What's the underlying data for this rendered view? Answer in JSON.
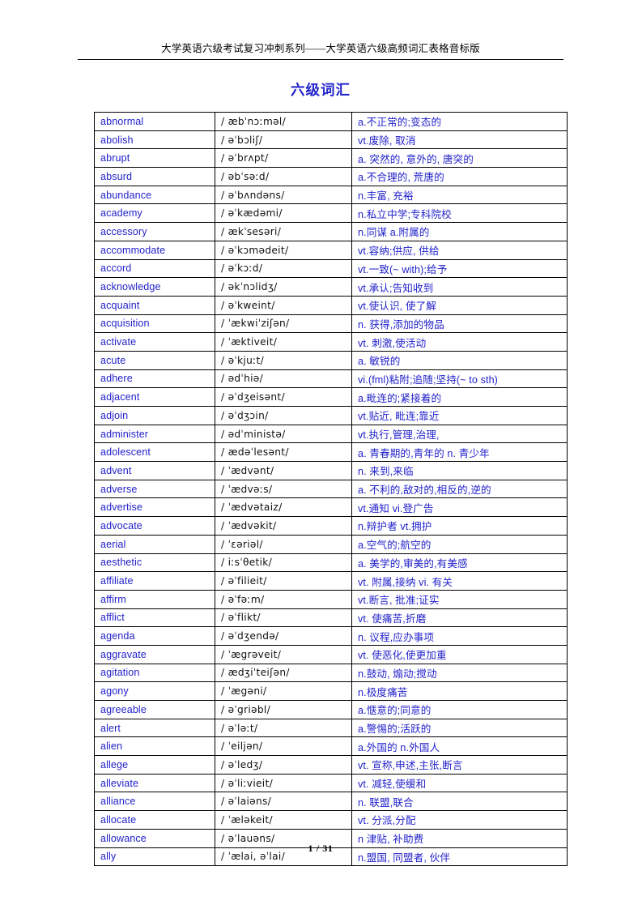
{
  "header": {
    "running_head": "大学英语六级考试复习冲刺系列——大学英语六级高频词汇表格音标版"
  },
  "title": "六级词汇",
  "colors": {
    "text_blue": "#2222cc",
    "text_black": "#000000",
    "border": "#000000",
    "background": "#ffffff"
  },
  "table": {
    "columns": [
      "word",
      "phonetic",
      "meaning"
    ],
    "rows": [
      {
        "word": "abnormal",
        "phonetic": "/ æbˈnɔːməl/",
        "meaning": "a.不正常的;变态的"
      },
      {
        "word": "abolish",
        "phonetic": "/ əˈbɔliʃ/",
        "meaning": "vt.废除, 取消"
      },
      {
        "word": "abrupt",
        "phonetic": "/ əˈbrʌpt/",
        "meaning": "a. 突然的, 意外的, 唐突的"
      },
      {
        "word": "absurd",
        "phonetic": "/ əbˈsəːd/",
        "meaning": "a.不合理的, 荒唐的"
      },
      {
        "word": "abundance",
        "phonetic": "/ əˈbʌndəns/",
        "meaning": "n.丰富, 充裕"
      },
      {
        "word": "academy",
        "phonetic": "/ əˈkædəmi/",
        "meaning": "n.私立中学;专科院校"
      },
      {
        "word": "accessory",
        "phonetic": "/ ækˈsesəri/",
        "meaning": "n.同谋 a.附属的"
      },
      {
        "word": "accommodate",
        "phonetic": "/ əˈkɔmədeit/",
        "meaning": "vt.容纳;供应, 供给"
      },
      {
        "word": "accord",
        "phonetic": "/ əˈkɔːd/",
        "meaning": "vt.一致(~ with);给予"
      },
      {
        "word": "acknowledge",
        "phonetic": "/ əkˈnɔlidʒ/",
        "meaning": "vt.承认;告知收到"
      },
      {
        "word": "acquaint",
        "phonetic": "/ əˈkweint/",
        "meaning": "vt.使认识, 使了解"
      },
      {
        "word": "acquisition",
        "phonetic": "/ ˈækwiˈziʃən/",
        "meaning": "n. 获得,添加的物品"
      },
      {
        "word": "activate",
        "phonetic": "/ ˈæktiveit/",
        "meaning": "vt. 刺激,使活动"
      },
      {
        "word": "acute",
        "phonetic": "/ əˈkjuːt/",
        "meaning": "a. 敏锐的"
      },
      {
        "word": "adhere",
        "phonetic": "/ ədˈhiə/",
        "meaning": "vi.(fml)粘附;追随;坚持(~ to sth)"
      },
      {
        "word": "adjacent",
        "phonetic": "/ əˈdʒeisənt/",
        "meaning": "a.毗连的;紧接着的"
      },
      {
        "word": "adjoin",
        "phonetic": "/ əˈdʒɔin/",
        "meaning": "vt.贴近, 毗连;靠近"
      },
      {
        "word": "administer",
        "phonetic": "/ ədˈministə/",
        "meaning": "vt.执行,管理,治理,"
      },
      {
        "word": "adolescent",
        "phonetic": "/ ædəˈlesənt/",
        "meaning": "a. 青春期的,青年的 n. 青少年"
      },
      {
        "word": "advent",
        "phonetic": "/ ˈædvənt/",
        "meaning": "n. 来到,来临"
      },
      {
        "word": "adverse",
        "phonetic": "/ ˈædvəːs/",
        "meaning": "a. 不利的,敌对的,相反的,逆的"
      },
      {
        "word": "advertise",
        "phonetic": "/ ˈædvətaiz/",
        "meaning": "vt.通知 vi.登广告"
      },
      {
        "word": "advocate",
        "phonetic": "/ ˈædvəkit/",
        "meaning": "n.辩护者 vt.拥护"
      },
      {
        "word": "aerial",
        "phonetic": "/ ˈɛəriəl/",
        "meaning": "a.空气的;航空的"
      },
      {
        "word": "aesthetic",
        "phonetic": "/ iːsˈθetik/",
        "meaning": "a. 美学的,审美的,有美感"
      },
      {
        "word": "affiliate",
        "phonetic": "/ əˈfilieit/",
        "meaning": "vt. 附属,接纳 vi. 有关"
      },
      {
        "word": "affirm",
        "phonetic": "/ əˈfəːm/",
        "meaning": "vt.断言, 批准;证实"
      },
      {
        "word": "afflict",
        "phonetic": "/ əˈflikt/",
        "meaning": "vt. 使痛苦,折磨"
      },
      {
        "word": "agenda",
        "phonetic": "/ əˈdʒendə/",
        "meaning": "n. 议程,应办事项"
      },
      {
        "word": "aggravate",
        "phonetic": "/ ˈægrəveit/",
        "meaning": "vt. 使恶化,使更加重"
      },
      {
        "word": "agitation",
        "phonetic": "/ ædʒiˈteiʃən/",
        "meaning": "n.鼓动, 煽动;搅动"
      },
      {
        "word": "agony",
        "phonetic": "/ ˈægəni/",
        "meaning": "n.极度痛苦"
      },
      {
        "word": "agreeable",
        "phonetic": "/ əˈgriəbl/",
        "meaning": "a.惬意的;同意的"
      },
      {
        "word": "alert",
        "phonetic": "/ əˈləːt/",
        "meaning": "a.警惕的;活跃的"
      },
      {
        "word": "alien",
        "phonetic": "/ ˈeiljən/",
        "meaning": "a.外国的 n.外国人"
      },
      {
        "word": "allege",
        "phonetic": "/ əˈledʒ/",
        "meaning": "vt. 宣称,申述,主张,断言"
      },
      {
        "word": "alleviate",
        "phonetic": "/ əˈliːvieit/",
        "meaning": "vt. 减轻,使缓和"
      },
      {
        "word": "alliance",
        "phonetic": "/ əˈlaiəns/",
        "meaning": "n. 联盟,联合"
      },
      {
        "word": "allocate",
        "phonetic": "/ ˈæləkeit/",
        "meaning": "vt. 分派,分配"
      },
      {
        "word": "allowance",
        "phonetic": "/ əˈlauəns/",
        "meaning": "n 津贴, 补助费"
      },
      {
        "word": "ally",
        "phonetic": "/ ˈælai, əˈlai/",
        "meaning": "n.盟国, 同盟者, 伙伴"
      }
    ]
  },
  "footer": {
    "page_label": "1 / 31"
  }
}
